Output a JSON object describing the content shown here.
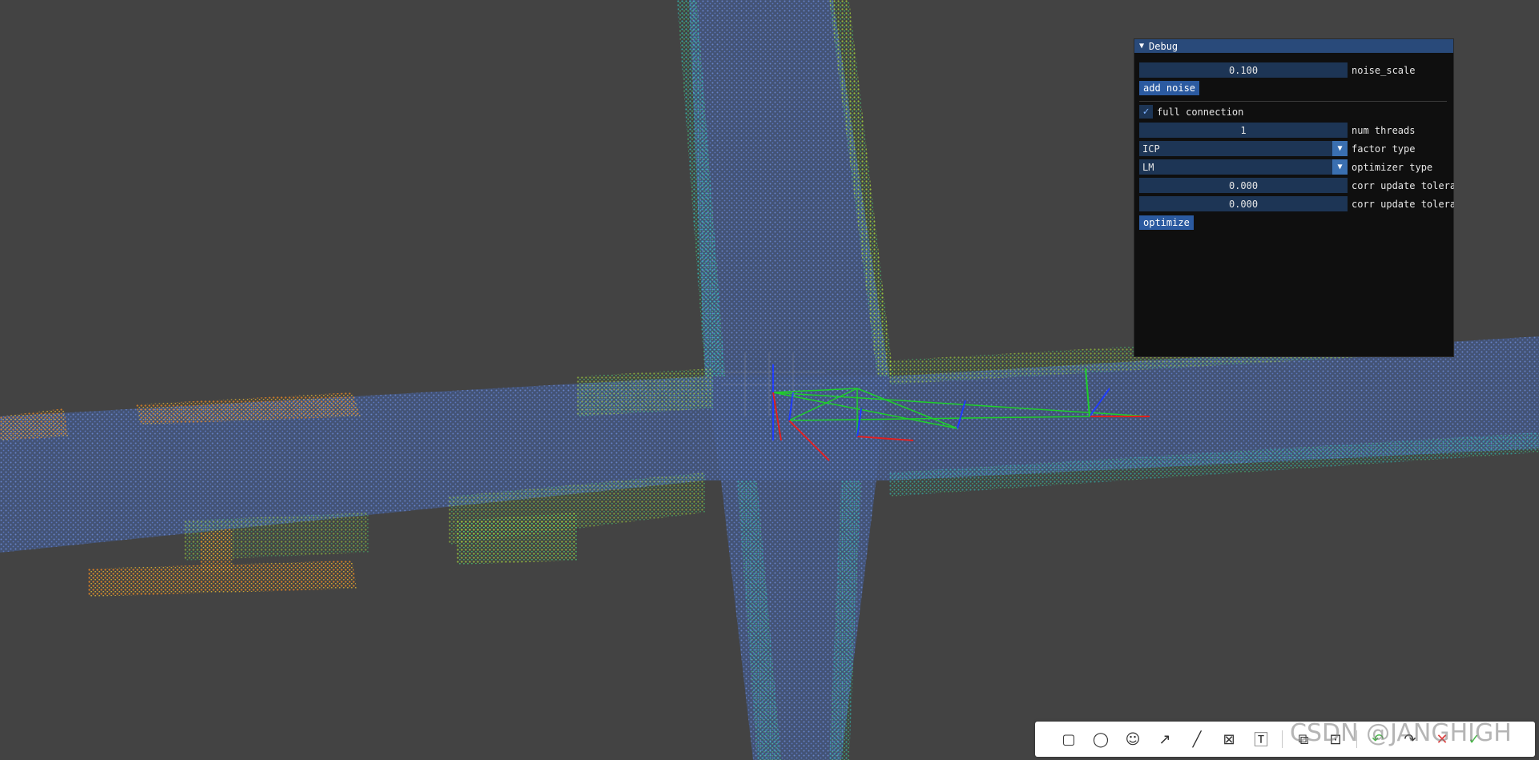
{
  "panel": {
    "title": "Debug",
    "noise_scale_value": "0.100",
    "noise_scale_label": "noise_scale",
    "add_noise_label": "add noise",
    "full_connection_label": "full connection",
    "full_connection_checked": true,
    "num_threads_value": "1",
    "num_threads_label": "num threads",
    "factor_type_value": "ICP",
    "factor_type_label": "factor type",
    "optimizer_type_value": "LM",
    "optimizer_type_label": "optimizer type",
    "corr_update_tol1_value": "0.000",
    "corr_update_tol1_label": "corr update tolera",
    "corr_update_tol2_value": "0.000",
    "corr_update_tol2_label": "corr update tolera",
    "optimize_label": "optimize"
  },
  "toolbar": {
    "tools": [
      "rectangle-icon",
      "ellipse-icon",
      "emoji-icon",
      "arrow-icon",
      "line-icon",
      "mosaic-icon",
      "text-icon",
      "pin-icon",
      "save-icon",
      "undo-icon",
      "redo-icon",
      "close-icon",
      "confirm-icon"
    ],
    "watermark": "CSDN @JANGHIGH"
  },
  "colors": {
    "background": "#434343",
    "panel_bg": "#0f0f0f",
    "panel_title": "#294a7a",
    "field": "#1d3555",
    "button": "#2b5aa0"
  }
}
